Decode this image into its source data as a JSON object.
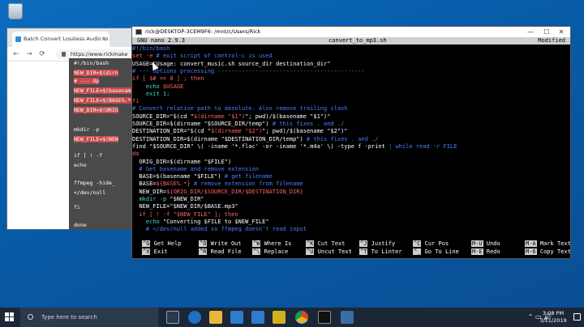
{
  "desktop": {
    "recycle_bin_label": "Recycle Bin"
  },
  "browser": {
    "tab_title": "Batch Convert Lossless Audio to",
    "tab_close": "×",
    "address": "https://www.rickmake",
    "back": "←",
    "forward": "→",
    "reload": "⟳"
  },
  "snippet": {
    "lines": [
      "#!/bin/bash",
      "NEW_DIR=$(dirn",
      "# --- Op",
      "NEW_FILE=$(basename",
      "NEW_FILE=$(BASE%.*}",
      "NEW_DIR=$(ORIG",
      "mkdir -p",
      "NEW_FILE=$(NEW",
      "if [ ! -f",
      "echo",
      "ffmpeg -hide_",
      "</dev/null",
      "fi",
      "done"
    ]
  },
  "terminal": {
    "title": "rick@DESKTOP-3CEM9F6: /mnt/c/Users/Rick",
    "nano_version": "GNU nano 2.9.3",
    "filename": "convert_to_mp3.sh",
    "status": "Modified",
    "min": "—",
    "max": "☐",
    "close": "✕",
    "lines": [
      [
        {
          "c": "c-cm",
          "t": "#!/bin/bash"
        }
      ],
      [
        {
          "c": "c-kw",
          "t": "set -e"
        },
        {
          "c": "c-cm",
          "t": " # exit script of control-c is used"
        }
      ],
      [
        {
          "c": "c-tx",
          "t": "USAGE=\"Usage: convert_music.sh source_dir destination_dir\""
        }
      ],
      [
        {
          "c": "c-cm",
          "t": "# --- Options processing -------------------------------------------"
        }
      ],
      [
        {
          "c": "c-kw",
          "t": "if [ $# == 0 ] ; then"
        }
      ],
      [
        {
          "c": "c-tx",
          "t": "    "
        },
        {
          "c": "c-cy",
          "t": "echo"
        },
        {
          "c": "c-var",
          "t": " $USAGE"
        }
      ],
      [
        {
          "c": "c-tx",
          "t": "    "
        },
        {
          "c": "c-cy",
          "t": "exit 1;"
        }
      ],
      [
        {
          "c": "c-kw",
          "t": "fi"
        }
      ],
      [
        {
          "c": "c-cm",
          "t": "# Convert relative path to absolute. Also remove trailing slash"
        }
      ],
      [
        {
          "c": "c-tx",
          "t": "SOURCE_DIR=\"$(cd \""
        },
        {
          "c": "c-var",
          "t": "$(dirname \"$1\")"
        },
        {
          "c": "c-tx",
          "t": "\"; pwd)/$(basename \"$1\")\""
        }
      ],
      [
        {
          "c": "c-tx",
          "t": "SOURCE_DIR=$(dirname \"$SOURCE_DIR/temp\")"
        },
        {
          "c": "c-cm",
          "t": " # this fixes . and ./"
        }
      ],
      [
        {
          "c": "c-tx",
          "t": "DESTINATION_DIR=\"$(cd \""
        },
        {
          "c": "c-var",
          "t": "$(dirname \"$2\")"
        },
        {
          "c": "c-tx",
          "t": "\"; pwd)/$(basename \"$2\")\""
        }
      ],
      [
        {
          "c": "c-tx",
          "t": "DESTINATION_DIR=$(dirname \"$DESTINATION_DIR/temp\")"
        },
        {
          "c": "c-cm",
          "t": " # this fixes . and ./"
        }
      ],
      [
        {
          "c": "c-tx",
          "t": "find \"$SOURCE_DIR\" \\( -iname '*.flac' -or -iname '*.m4a' \\) -type f -print "
        },
        {
          "c": "c-cm",
          "t": "| while read -r FILE"
        }
      ],
      [
        {
          "c": "c-kw",
          "t": "do"
        }
      ],
      [
        {
          "c": "c-tx",
          "t": "  ORIG_DIR=$(dirname \"$FILE\")"
        }
      ],
      [
        {
          "c": "c-cm",
          "t": "  # Get basename and remove extension"
        }
      ],
      [
        {
          "c": "c-tx",
          "t": "  BASE=$(basename \"$FILE\")"
        },
        {
          "c": "c-cm",
          "t": " # get filename"
        }
      ],
      [
        {
          "c": "c-tx",
          "t": "  BASE="
        },
        {
          "c": "c-var",
          "t": "${BASE%.*}"
        },
        {
          "c": "c-cm",
          "t": " # remove extension from filename"
        }
      ],
      [
        {
          "c": "c-tx",
          "t": "  NEW_DIR="
        },
        {
          "c": "c-var",
          "t": "${ORIG_DIR/$SOURCE_DIR/$DESTINATION_DIR}"
        }
      ],
      [
        {
          "c": "c-tx",
          "t": "  "
        },
        {
          "c": "c-cy",
          "t": "mkdir -p"
        },
        {
          "c": "c-tx",
          "t": " \"$NEW_DIR\""
        }
      ],
      [
        {
          "c": "c-tx",
          "t": "  NEW_FILE=\"$NEW_DIR/$BASE.mp3\""
        }
      ],
      [
        {
          "c": "c-kw",
          "t": "  if [ ! -f \"$NEW_FILE\" ]; then"
        }
      ],
      [
        {
          "c": "c-tx",
          "t": "    "
        },
        {
          "c": "c-cy",
          "t": "echo"
        },
        {
          "c": "c-tx",
          "t": " \"Converting $FILE to $NEW_FILE\""
        }
      ],
      [
        {
          "c": "c-cm",
          "t": "    # </dev/null added so ffmpeg doesn't read input"
        }
      ]
    ],
    "shortcuts": [
      {
        "key": "^G",
        "label": "Get Help"
      },
      {
        "key": "^O",
        "label": "Write Out"
      },
      {
        "key": "^W",
        "label": "Where Is"
      },
      {
        "key": "^K",
        "label": "Cut Text"
      },
      {
        "key": "^J",
        "label": "Justify"
      },
      {
        "key": "^C",
        "label": "Cur Pos"
      },
      {
        "key": "M-U",
        "label": "Undo"
      },
      {
        "key": "M-A",
        "label": "Mark Text"
      },
      {
        "key": "^X",
        "label": "Exit"
      },
      {
        "key": "^R",
        "label": "Read File"
      },
      {
        "key": "^\\",
        "label": "Replace"
      },
      {
        "key": "^U",
        "label": "Uncut Text"
      },
      {
        "key": "^T",
        "label": "To Linter"
      },
      {
        "key": "^_",
        "label": "Go To Line"
      },
      {
        "key": "M-E",
        "label": "Redo"
      },
      {
        "key": "M-6",
        "label": "Copy Text"
      }
    ]
  },
  "taskbar": {
    "search_placeholder": "Type here to search",
    "time": "3:08 PM",
    "date": "3/11/2019",
    "tray_icons": "⌃ ▭ 🔊"
  }
}
